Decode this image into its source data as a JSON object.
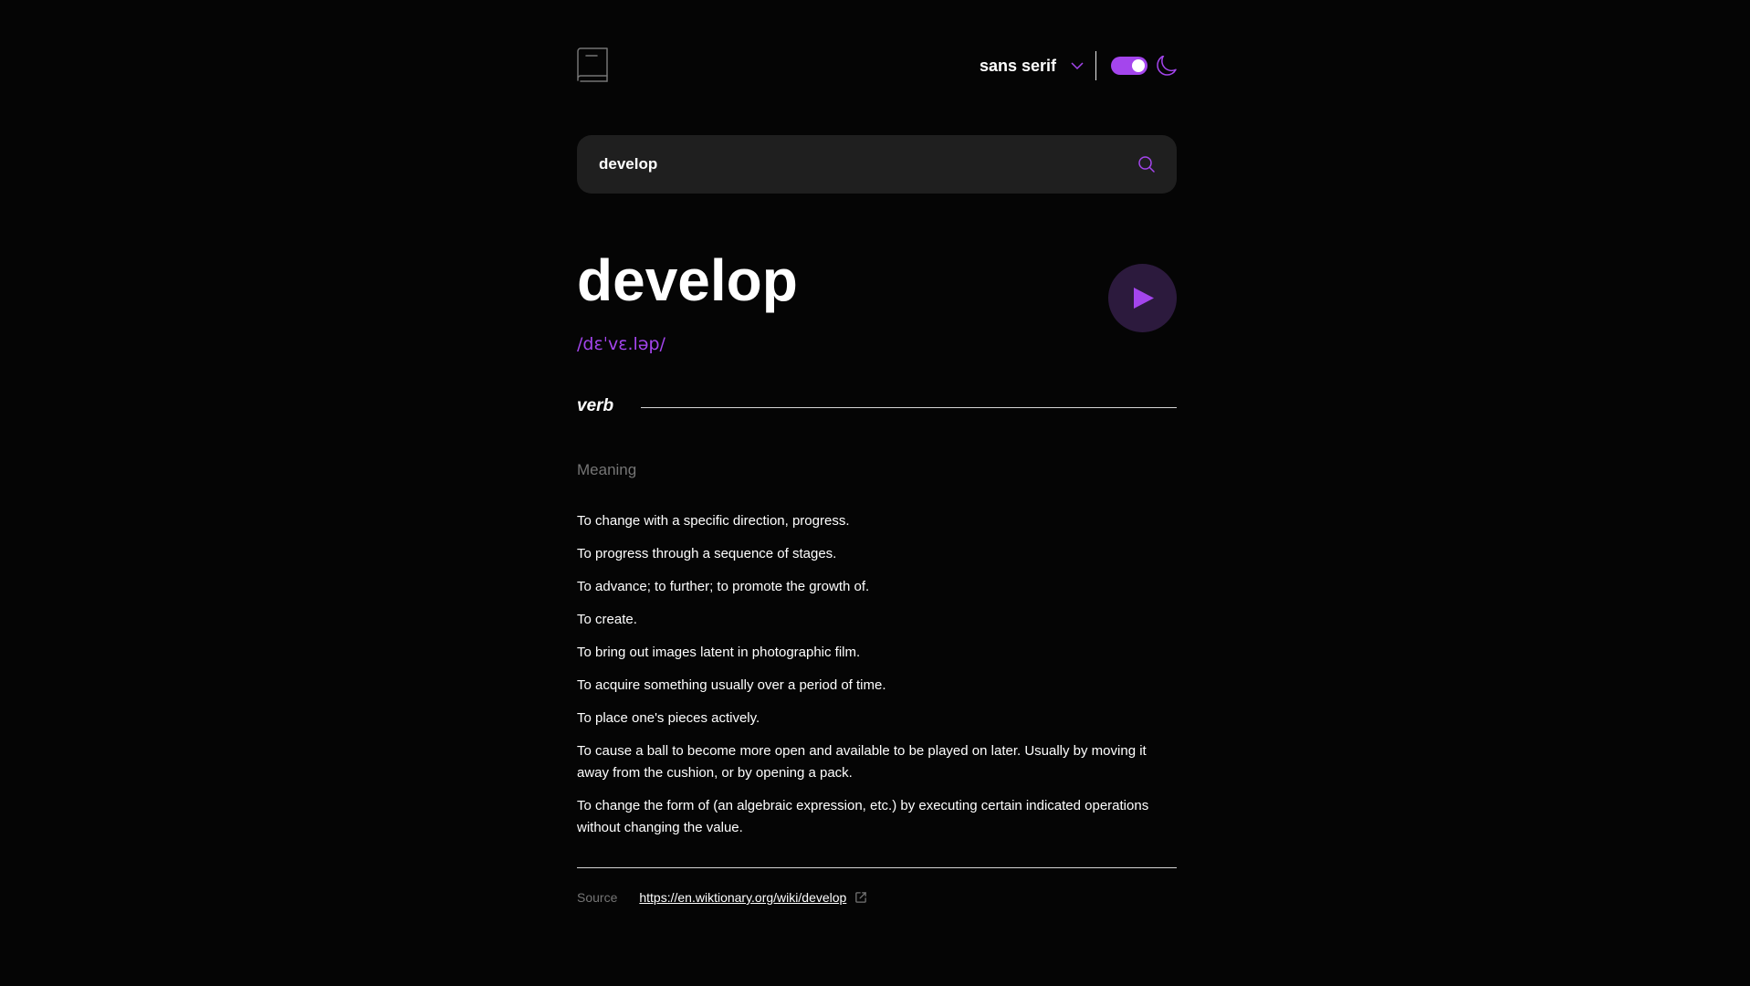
{
  "header": {
    "font_label": "sans serif",
    "theme_toggle_on": true,
    "accent_color": "#a445ed",
    "icons": {
      "logo": "book-icon",
      "font_dropdown": "chevron-down-icon",
      "theme": "moon-icon"
    }
  },
  "search": {
    "value": "develop",
    "icon": "search-icon"
  },
  "entry": {
    "word": "develop",
    "phonetic": "/dɛˈvɛ.ləp/",
    "play_icon": "play-icon",
    "part_of_speech": "verb",
    "meaning_label": "Meaning",
    "definitions": [
      "To change with a specific direction, progress.",
      "To progress through a sequence of stages.",
      "To advance; to further; to promote the growth of.",
      "To create.",
      "To bring out images latent in photographic film.",
      "To acquire something usually over a period of time.",
      "To place one's pieces actively.",
      "To cause a ball to become more open and available to be played on later. Usually by moving it away from the cushion, or by opening a pack.",
      "To change the form of (an algebraic expression, etc.) by executing certain indicated operations without changing the value."
    ]
  },
  "source": {
    "label": "Source",
    "url": "https://en.wiktionary.org/wiki/develop",
    "icon": "external-link-icon"
  }
}
